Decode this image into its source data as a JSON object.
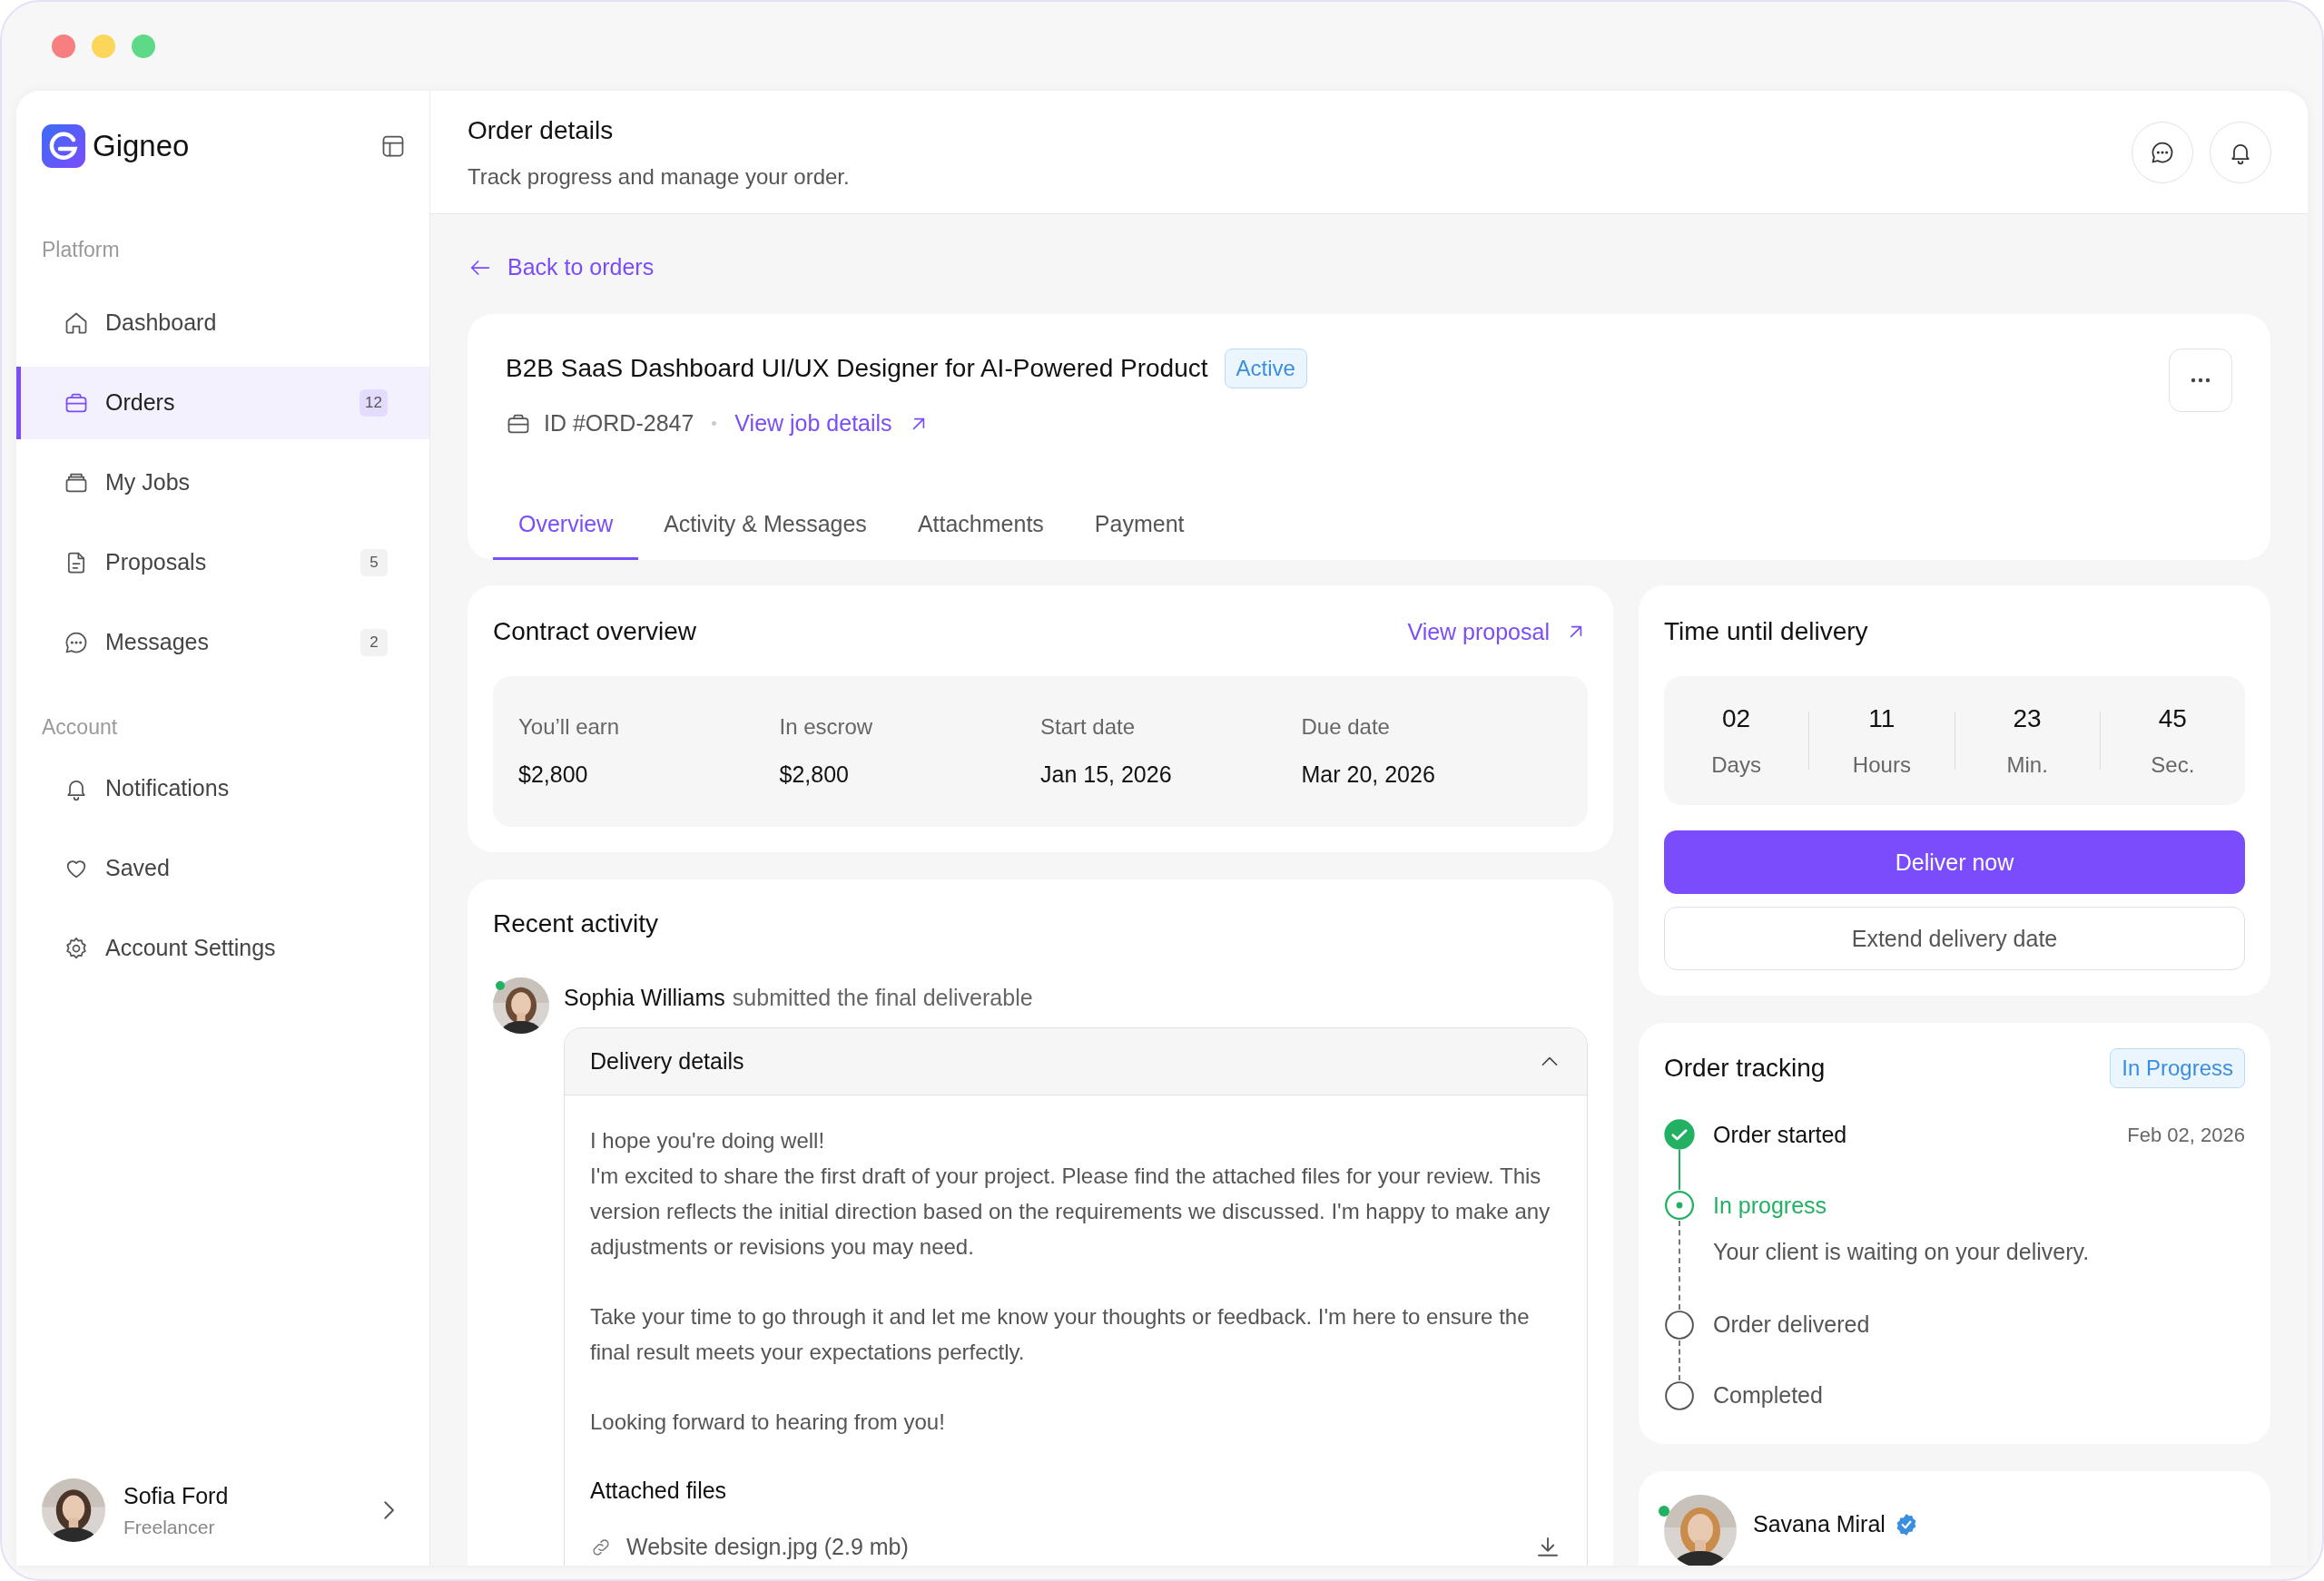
{
  "sidebar": {
    "brand": "Gigneo",
    "sections": [
      {
        "title": "Platform",
        "items": [
          {
            "label": "Dashboard",
            "selected": false
          },
          {
            "label": "Orders",
            "badge": "12",
            "selected": true
          },
          {
            "label": "My Jobs",
            "selected": false
          },
          {
            "label": "Proposals",
            "badge": "5",
            "selected": false
          },
          {
            "label": "Messages",
            "badge": "2",
            "selected": false
          }
        ]
      },
      {
        "title": "Account",
        "items": [
          {
            "label": "Notifications",
            "selected": false
          },
          {
            "label": "Saved",
            "selected": false
          },
          {
            "label": "Account Settings",
            "selected": false
          }
        ]
      }
    ],
    "user": {
      "name": "Sofia Ford",
      "role": "Freelancer"
    }
  },
  "header": {
    "title": "Order details",
    "subtitle": "Track progress and manage your order."
  },
  "back_link": "Back to orders",
  "order": {
    "title": "B2B SaaS Dashboard UI/UX Designer for AI-Powered Product",
    "status": "Active",
    "id": "ID #ORD-2847",
    "link": "View job details",
    "tabs": [
      {
        "label": "Overview",
        "selected": true
      },
      {
        "label": "Activity & Messages",
        "selected": false
      },
      {
        "label": "Attachments",
        "selected": false
      },
      {
        "label": "Payment",
        "selected": false
      }
    ]
  },
  "contract": {
    "title": "Contract overview",
    "link": "View proposal",
    "fields": [
      {
        "label": "You’ll earn",
        "value": "$2,800"
      },
      {
        "label": "In escrow",
        "value": "$2,800"
      },
      {
        "label": "Start date",
        "value": "Jan 15, 2026"
      },
      {
        "label": "Due date",
        "value": "Mar 20, 2026"
      }
    ]
  },
  "activity": {
    "title": "Recent activity",
    "entries": [
      {
        "name": "Sophia Williams",
        "action": "submitted the final deliverable",
        "online": true,
        "details": {
          "title": "Delivery details",
          "expanded": true,
          "paragraphs": [
            "I hope you're doing well!\nI'm excited to share the first draft of your project. Please find the attached files for your review. This version reflects the initial direction based on the requirements we discussed. I'm happy to make any adjustments or revisions you may need.",
            "Take your time to go through it and let me know your thoughts or feedback. I'm here to ensure the final result meets your expectations perfectly.",
            "Looking forward to hearing from you!"
          ],
          "files_title": "Attached files",
          "files": [
            "Website design.jpg (2.9 mb)"
          ]
        }
      }
    ]
  },
  "delivery": {
    "title": "Time until delivery",
    "units": [
      {
        "value": "02",
        "label": "Days"
      },
      {
        "value": "11",
        "label": "Hours"
      },
      {
        "value": "23",
        "label": "Min."
      },
      {
        "value": "45",
        "label": "Sec."
      }
    ],
    "primary": "Deliver now",
    "secondary": "Extend delivery date"
  },
  "tracking": {
    "title": "Order tracking",
    "status": "In Progress",
    "steps": [
      {
        "label": "Order started",
        "completed": true,
        "current": false,
        "date": "Feb 02, 2026"
      },
      {
        "label": "In progress",
        "completed": false,
        "current": true,
        "note": "Your client is waiting on your delivery."
      },
      {
        "label": "Order delivered",
        "completed": false,
        "current": false
      },
      {
        "label": "Completed",
        "completed": false,
        "current": false
      }
    ]
  },
  "contact": {
    "name": "Savana Miral",
    "verified": true,
    "online": true
  }
}
